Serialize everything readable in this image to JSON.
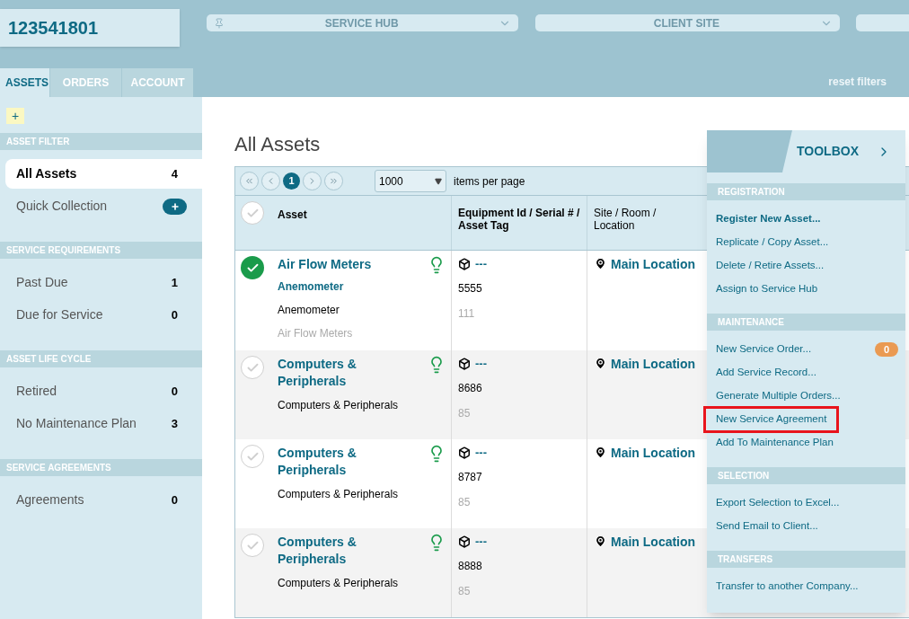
{
  "account_id": "123541801",
  "filters": [
    {
      "label": "SERVICE HUB",
      "pinned": true
    },
    {
      "label": "CLIENT SITE",
      "pinned": false
    }
  ],
  "reset_filters": "reset filters",
  "tabs": [
    {
      "label": "ASSETS",
      "selected": true
    },
    {
      "label": "ORDERS",
      "selected": false
    },
    {
      "label": "ACCOUNT",
      "selected": false
    }
  ],
  "add_button": "+",
  "sidebar": [
    {
      "title": "ASSET FILTER",
      "items": [
        {
          "kind": "count",
          "label": "All Assets",
          "count": "4",
          "selected": true
        },
        {
          "kind": "add",
          "label": "Quick Collection",
          "selected": false
        }
      ]
    },
    {
      "title": "SERVICE REQUIREMENTS",
      "items": [
        {
          "kind": "count",
          "label": "Past Due",
          "count": "1",
          "selected": false
        },
        {
          "kind": "count",
          "label": "Due for Service",
          "count": "0",
          "selected": false
        }
      ]
    },
    {
      "title": "ASSET LIFE CYCLE",
      "items": [
        {
          "kind": "count",
          "label": "Retired",
          "count": "0",
          "selected": false
        },
        {
          "kind": "count",
          "label": "No Maintenance Plan",
          "count": "3",
          "selected": false
        }
      ]
    },
    {
      "title": "SERVICE AGREEMENTS",
      "items": [
        {
          "kind": "count",
          "label": "Agreements",
          "count": "0",
          "selected": false
        }
      ]
    }
  ],
  "page_title": "All Assets",
  "pager": {
    "pages": [
      {
        "label": "1",
        "selected": true
      }
    ],
    "per_page": "1000",
    "per_page_label": "items per page"
  },
  "table": {
    "select_all": {
      "checked": false
    },
    "columns": [
      "Asset",
      "Equipment Id / Serial # / Asset Tag",
      "Site / Room / Location"
    ],
    "rows": [
      {
        "selected": true,
        "title": "Air Flow Meters",
        "subtitle": "Anemometer",
        "description": "Anemometer",
        "category": "Air Flow Meters",
        "equipment_id": "---",
        "serial": "5555",
        "tag": "111",
        "location": "Main Location"
      },
      {
        "selected": false,
        "title": "Computers & Peripherals",
        "description": "Computers & Peripherals",
        "equipment_id": "---",
        "serial": "8686",
        "tag": "85",
        "location": "Main Location"
      },
      {
        "selected": false,
        "title": "Computers & Peripherals",
        "description": "Computers & Peripherals",
        "equipment_id": "---",
        "serial": "8787",
        "tag": "85",
        "location": "Main Location"
      },
      {
        "selected": false,
        "title": "Computers & Peripherals",
        "description": "Computers & Peripherals",
        "equipment_id": "---",
        "serial": "8888",
        "tag": "85",
        "location": "Main Location"
      }
    ]
  },
  "toolbox": {
    "title": "TOOLBOX",
    "sections": [
      {
        "title": "REGISTRATION",
        "items": [
          {
            "label": "Register New Asset...",
            "primary": true,
            "highlighted": false
          },
          {
            "label": "Replicate / Copy Asset...",
            "primary": false,
            "highlighted": false
          },
          {
            "label": "Delete / Retire Assets...",
            "primary": false,
            "highlighted": false
          },
          {
            "label": "Assign to Service Hub",
            "primary": false,
            "highlighted": false
          }
        ]
      },
      {
        "title": "MAINTENANCE",
        "items": [
          {
            "label": "New Service Order...",
            "badge": "0",
            "primary": false,
            "highlighted": false
          },
          {
            "label": "Add Service Record...",
            "primary": false,
            "highlighted": false
          },
          {
            "label": "Generate Multiple Orders...",
            "primary": false,
            "highlighted": false
          },
          {
            "label": "New Service Agreement",
            "primary": false,
            "highlighted": true
          },
          {
            "label": "Add To Maintenance Plan",
            "primary": false,
            "highlighted": false
          }
        ]
      },
      {
        "title": "SELECTION",
        "items": [
          {
            "label": "Export Selection to Excel...",
            "primary": false,
            "highlighted": false
          },
          {
            "label": "Send Email to Client...",
            "primary": false,
            "highlighted": false
          }
        ]
      },
      {
        "title": "TRANSFERS",
        "items": [
          {
            "label": "Transfer to another Company...",
            "primary": false,
            "highlighted": false
          }
        ]
      }
    ]
  }
}
